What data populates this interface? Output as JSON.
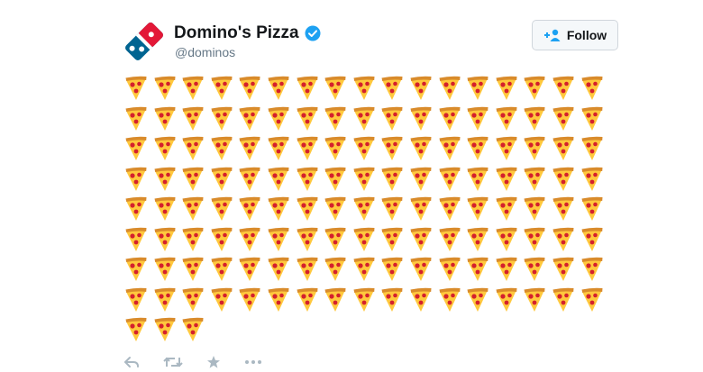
{
  "tweet": {
    "display_name": "Domino's Pizza",
    "handle": "@dominos",
    "follow_label": "Follow",
    "pizza_count": 139,
    "pizza_emoji_name": "pizza-slice-icon"
  },
  "colors": {
    "domino_blue": "#006491",
    "domino_red": "#e31837",
    "verified_blue": "#1da1f2",
    "pizza_crust": "#d98b2b",
    "pizza_cheese": "#ffc83d",
    "pepperoni": "#d4202c"
  },
  "actions": [
    "reply-icon",
    "retweet-icon",
    "like-star-icon",
    "more-icon"
  ]
}
